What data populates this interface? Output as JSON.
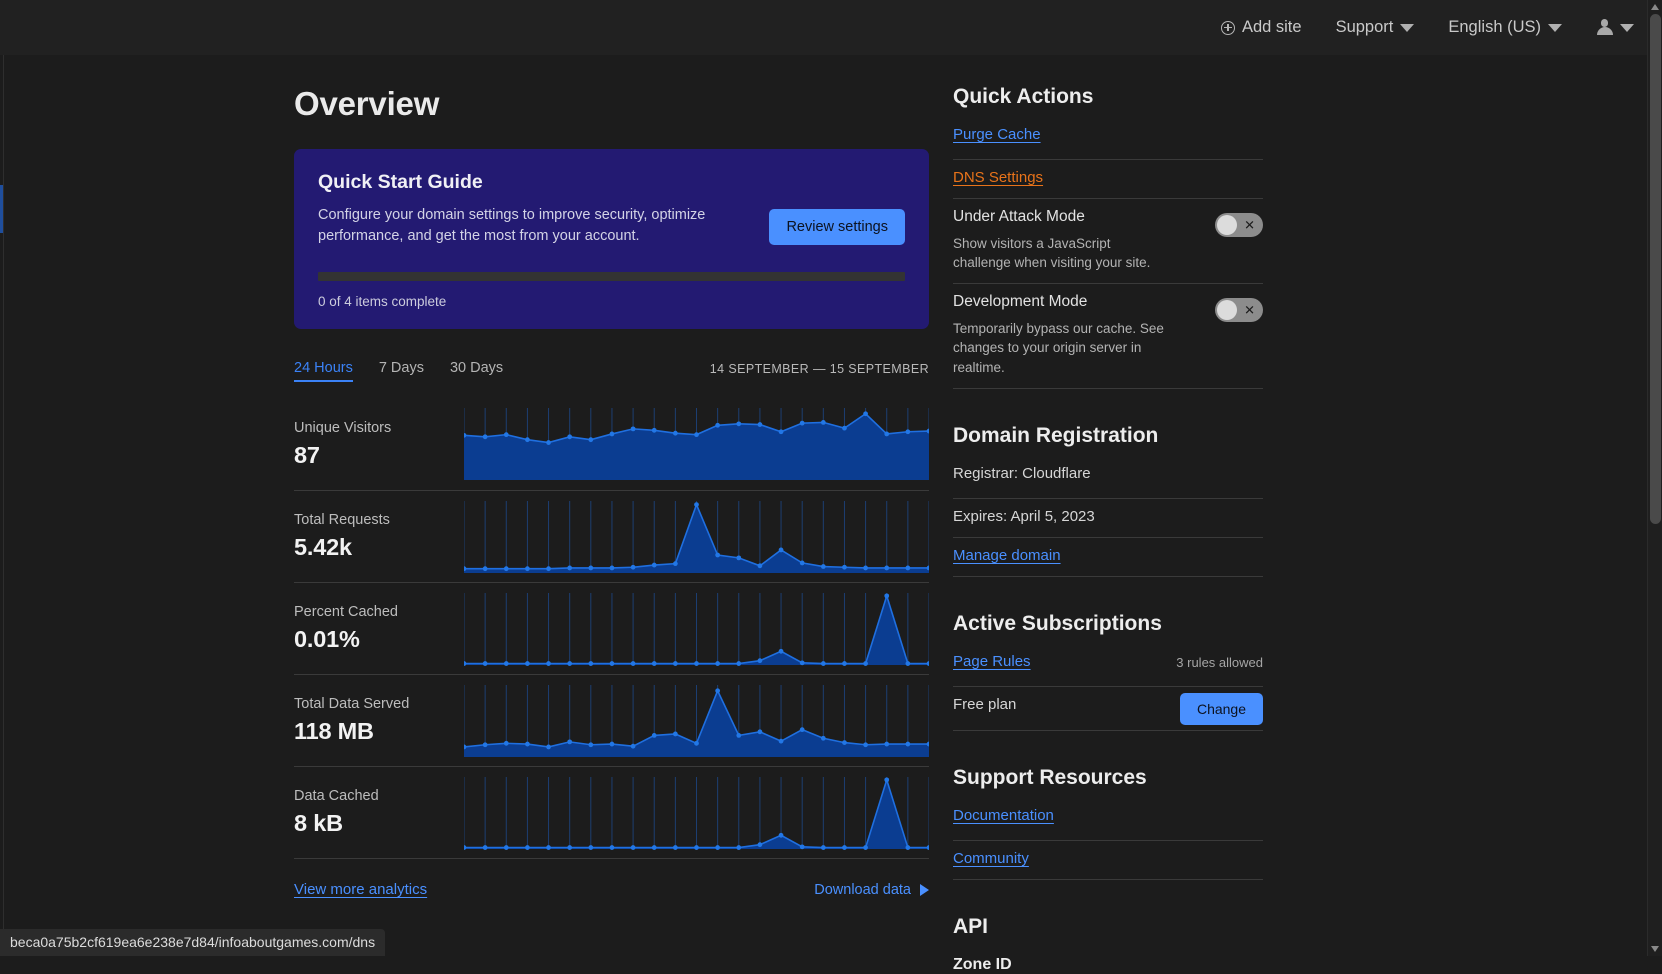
{
  "topbar": {
    "add_site": "Add site",
    "support": "Support",
    "language": "English (US)"
  },
  "main": {
    "page_title": "Overview",
    "quick_start": {
      "title": "Quick Start Guide",
      "description": "Configure your domain settings to improve security, optimize performance, and get the most from your account.",
      "button": "Review settings",
      "progress_label": "0 of 4 items complete",
      "progress_percent": 0,
      "accent_color": "#4a90ff",
      "card_color": "#231a72"
    },
    "tabs": [
      {
        "label": "24 Hours",
        "active": true
      },
      {
        "label": "7 Days",
        "active": false
      },
      {
        "label": "30 Days",
        "active": false
      }
    ],
    "date_range": "14 SEPTEMBER — 15 SEPTEMBER",
    "metrics": [
      {
        "label": "Unique Visitors",
        "value": "87"
      },
      {
        "label": "Total Requests",
        "value": "5.42k"
      },
      {
        "label": "Percent Cached",
        "value": "0.01%"
      },
      {
        "label": "Total Data Served",
        "value": "118 MB"
      },
      {
        "label": "Data Cached",
        "value": "8 kB"
      }
    ],
    "view_more": "View more analytics",
    "download": "Download data"
  },
  "sidebar": {
    "quick_actions_title": "Quick Actions",
    "purge_cache": "Purge Cache",
    "dns_settings": "DNS Settings",
    "under_attack": {
      "title": "Under Attack Mode",
      "description": "Show visitors a JavaScript challenge when visiting your site.",
      "enabled": false
    },
    "development_mode": {
      "title": "Development Mode",
      "description": "Temporarily bypass our cache. See changes to your origin server in realtime.",
      "enabled": false
    },
    "domain_registration_title": "Domain Registration",
    "registrar": "Registrar: Cloudflare",
    "expires": "Expires: April 5, 2023",
    "manage_domain": "Manage domain",
    "active_subscriptions_title": "Active Subscriptions",
    "page_rules": "Page Rules",
    "page_rules_meta": "3 rules allowed",
    "plan": "Free plan",
    "change_button": "Change",
    "support_resources_title": "Support Resources",
    "documentation": "Documentation",
    "community": "Community",
    "api_title": "API",
    "zone_id_title": "Zone ID"
  },
  "statusbar": {
    "url": "beca0a75b2cf619ea6e238e7d84/infoaboutgames.com/dns"
  },
  "chart_data": [
    {
      "type": "area",
      "title": "Unique Visitors",
      "total": 87,
      "xlabel": "",
      "ylabel": "",
      "ylim": [
        0,
        1
      ],
      "grid": true,
      "values": [
        0.62,
        0.6,
        0.63,
        0.56,
        0.52,
        0.6,
        0.56,
        0.64,
        0.71,
        0.69,
        0.65,
        0.63,
        0.76,
        0.78,
        0.77,
        0.67,
        0.79,
        0.8,
        0.72,
        0.92,
        0.64,
        0.67,
        0.68
      ]
    },
    {
      "type": "area",
      "title": "Total Requests",
      "total": "5.42k",
      "xlabel": "",
      "ylabel": "",
      "ylim": [
        0,
        1
      ],
      "grid": true,
      "values": [
        0.06,
        0.06,
        0.06,
        0.06,
        0.06,
        0.07,
        0.07,
        0.07,
        0.08,
        0.11,
        0.13,
        0.95,
        0.25,
        0.21,
        0.1,
        0.32,
        0.14,
        0.09,
        0.08,
        0.07,
        0.07,
        0.07,
        0.07
      ]
    },
    {
      "type": "area",
      "title": "Percent Cached",
      "total": "0.01%",
      "xlabel": "",
      "ylabel": "",
      "ylim": [
        0,
        1
      ],
      "grid": true,
      "values": [
        0.02,
        0.02,
        0.02,
        0.02,
        0.02,
        0.02,
        0.02,
        0.02,
        0.02,
        0.02,
        0.02,
        0.02,
        0.02,
        0.02,
        0.06,
        0.19,
        0.03,
        0.02,
        0.02,
        0.02,
        0.96,
        0.02,
        0.02
      ]
    },
    {
      "type": "area",
      "title": "Total Data Served",
      "total": "118 MB",
      "xlabel": "",
      "ylabel": "",
      "ylim": [
        0,
        1
      ],
      "grid": true,
      "values": [
        0.14,
        0.17,
        0.19,
        0.18,
        0.14,
        0.21,
        0.17,
        0.18,
        0.15,
        0.3,
        0.32,
        0.19,
        0.92,
        0.3,
        0.35,
        0.22,
        0.38,
        0.26,
        0.2,
        0.17,
        0.18,
        0.18,
        0.18
      ]
    },
    {
      "type": "area",
      "title": "Data Cached",
      "total": "8 kB",
      "xlabel": "",
      "ylabel": "",
      "ylim": [
        0,
        1
      ],
      "grid": true,
      "values": [
        0.02,
        0.02,
        0.02,
        0.02,
        0.02,
        0.02,
        0.02,
        0.02,
        0.02,
        0.02,
        0.02,
        0.02,
        0.02,
        0.02,
        0.06,
        0.19,
        0.03,
        0.02,
        0.02,
        0.02,
        0.96,
        0.02,
        0.02
      ]
    }
  ]
}
